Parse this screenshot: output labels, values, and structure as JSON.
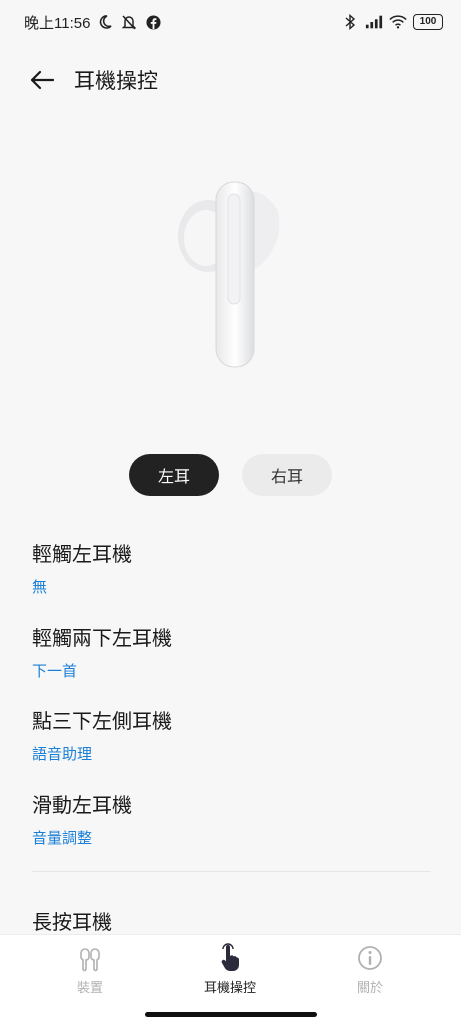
{
  "status_bar": {
    "time": "晚上11:56",
    "battery": "100",
    "icons": [
      "moon-icon",
      "mute-icon",
      "facebook-icon",
      "bluetooth-icon",
      "signal-icon",
      "wifi-icon",
      "battery-icon"
    ]
  },
  "header": {
    "title": "耳機操控"
  },
  "side_toggle": {
    "left_label": "左耳",
    "right_label": "右耳",
    "selected": "左耳"
  },
  "settings": [
    {
      "title": "輕觸左耳機",
      "value": "無"
    },
    {
      "title": "輕觸兩下左耳機",
      "value": "下一首"
    },
    {
      "title": "點三下左側耳機",
      "value": "語音助理"
    },
    {
      "title": "滑動左耳機",
      "value": "音量調整"
    }
  ],
  "long_press": {
    "title": "長按耳機"
  },
  "bottom_nav": [
    {
      "label": "裝置",
      "icon": "earbuds-icon",
      "active": false
    },
    {
      "label": "耳機操控",
      "icon": "touch-hand-icon",
      "active": true
    },
    {
      "label": "關於",
      "icon": "info-icon",
      "active": false
    }
  ],
  "colors": {
    "accent_blue": "#1a7fd6",
    "active_toggle": "#222222",
    "background": "#f7f7f7"
  }
}
